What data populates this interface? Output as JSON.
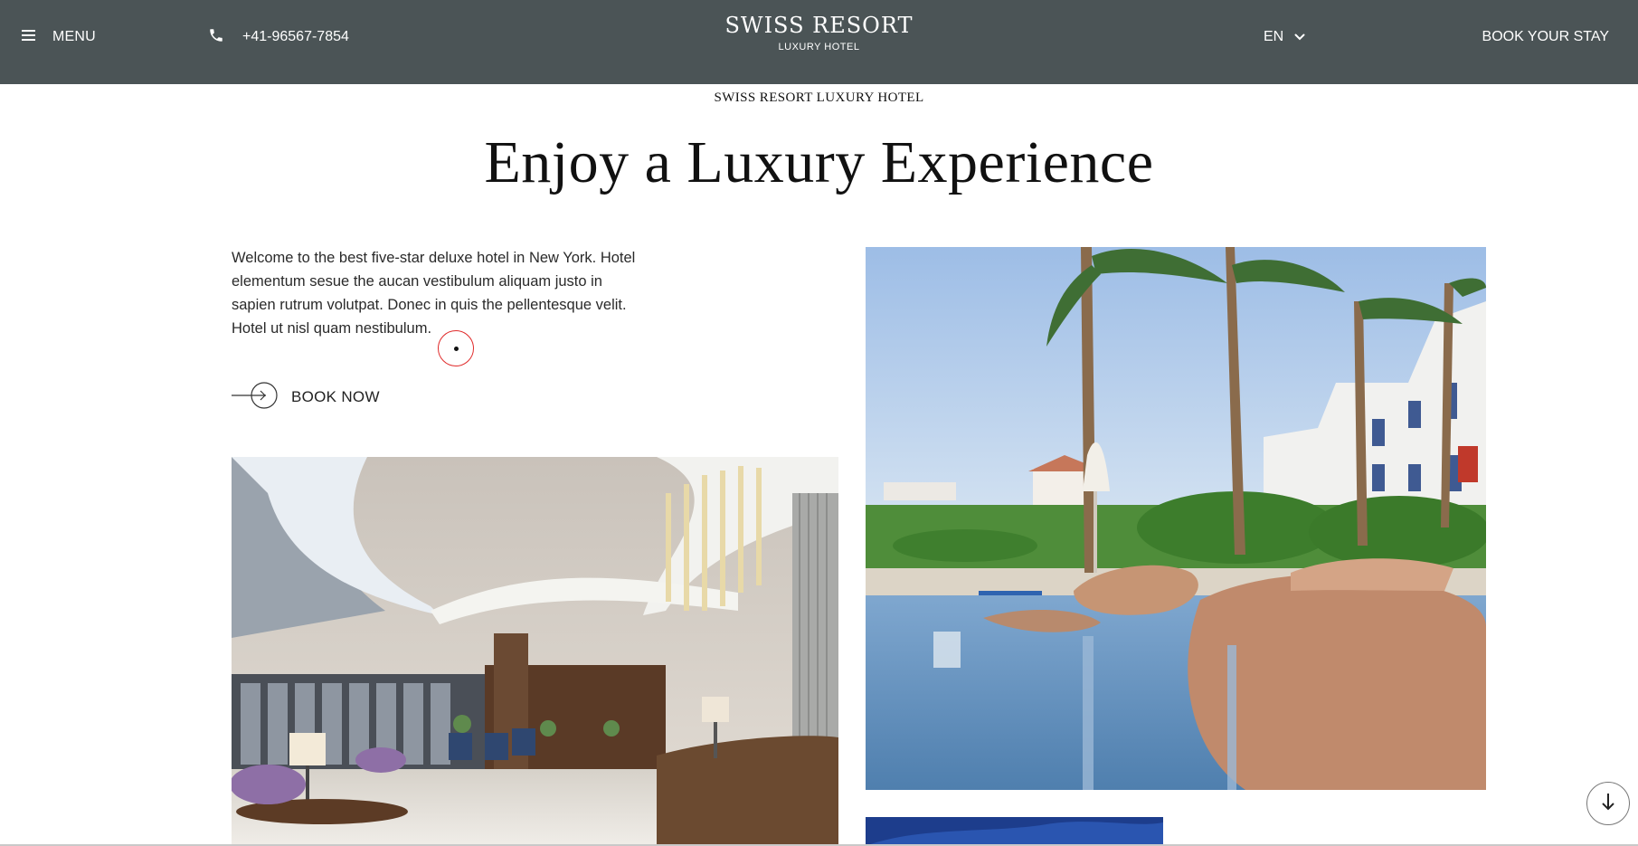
{
  "header": {
    "menu_label": "MENU",
    "phone_number": "+41-96567-7854",
    "brand_name": "SWISS RESORT",
    "brand_sub": "LUXURY HOTEL",
    "language": "EN",
    "book_stay_label": "BOOK YOUR STAY"
  },
  "hero": {
    "eyebrow": "SWISS RESORT LUXURY HOTEL",
    "title": "Enjoy a Luxury Experience",
    "intro": "Welcome to the best five-star deluxe hotel in New York. Hotel elementum sesue the aucan vestibulum aliquam justo in sapien rutrum volutpat. Donec in quis the pellentesque velit. Hotel ut nisl quam nestibulum.",
    "book_now_label": "BOOK NOW"
  },
  "icons": {
    "menu": "hamburger-icon",
    "phone": "phone-icon",
    "language": "chevron-down-icon",
    "book_now": "arrow-right-circle-icon",
    "scroll": "arrow-down-icon"
  },
  "colors": {
    "header_bg": "#4b5456",
    "header_text": "#ffffff",
    "body_text": "#222222",
    "cursor_ring": "#e02a2a"
  }
}
